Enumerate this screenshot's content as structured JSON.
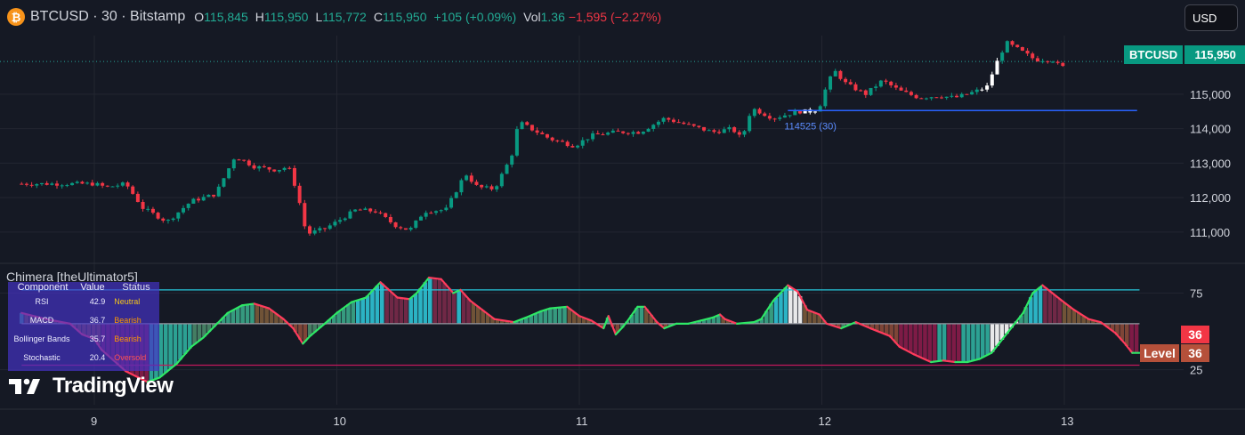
{
  "header": {
    "coin_symbol": "₿",
    "symbol_line": "BTCUSD · 30 · Bitstamp",
    "o_label": "O",
    "o_value": "115,845",
    "h_label": "H",
    "h_value": "115,950",
    "l_label": "L",
    "l_value": "115,772",
    "c_label": "C",
    "c_value": "115,950",
    "change": "+105 (+0.09%)",
    "vol_label": "Vol",
    "vol_value": "1.36",
    "vol_change": "−1,595 (−2.27%)"
  },
  "currency_button": "USD",
  "price_tag": {
    "name": "BTCUSD",
    "value": "115,950"
  },
  "indicator": {
    "title": "Chimera [theUltimator5]",
    "table": {
      "headers": [
        "Component",
        "Value",
        "Status"
      ],
      "rows": [
        {
          "component": "RSI",
          "value": "42.9",
          "status": "Neutral",
          "color": "#f5c518"
        },
        {
          "component": "MACD",
          "value": "36.7",
          "status": "Bearish",
          "color": "#ff9800"
        },
        {
          "component": "Bollinger Bands",
          "value": "35.7",
          "status": "Bearish",
          "color": "#ff9800"
        },
        {
          "component": "Stochastic",
          "value": "20.4",
          "status": "Oversold",
          "color": "#ff5252"
        }
      ]
    },
    "current_badge": "36",
    "level_label": "Level",
    "level_value": "36",
    "level_color": "#b5503a",
    "current_color": "#f23645"
  },
  "logo_text": "TradingView",
  "chart_data": [
    {
      "type": "candlestick",
      "title": "BTCUSD · 30 · Bitstamp",
      "y_ticks": [
        111000,
        112000,
        113000,
        114000,
        115000
      ],
      "y_tick_labels": [
        "111,000",
        "112,000",
        "113,000",
        "114,000",
        "115,000"
      ],
      "ylim": [
        110300,
        116700
      ],
      "x_ticks": [
        "9",
        "10",
        "11",
        "12",
        "13"
      ],
      "last_price": 115950,
      "horizontal_level": {
        "value": 114525,
        "label": "114525 (30)",
        "color": "#2962ff"
      },
      "close_path": [
        [
          0,
          112400
        ],
        [
          0.05,
          112300
        ],
        [
          0.13,
          112400
        ],
        [
          0.2,
          111700
        ],
        [
          0.3,
          111300
        ],
        [
          0.4,
          111900
        ],
        [
          0.5,
          112100
        ],
        [
          0.58,
          113200
        ],
        [
          0.66,
          112900
        ],
        [
          0.75,
          112800
        ],
        [
          0.8,
          112900
        ],
        [
          0.84,
          112100
        ],
        [
          0.86,
          111300
        ],
        [
          0.88,
          110950
        ],
        [
          0.95,
          111100
        ],
        [
          1.0,
          111300
        ],
        [
          1.08,
          111650
        ],
        [
          1.16,
          111600
        ],
        [
          1.24,
          111200
        ],
        [
          1.3,
          111050
        ],
        [
          1.36,
          111600
        ],
        [
          1.45,
          111650
        ],
        [
          1.5,
          112300
        ],
        [
          1.53,
          112700
        ],
        [
          1.58,
          112300
        ],
        [
          1.65,
          112250
        ],
        [
          1.72,
          113200
        ],
        [
          1.75,
          114200
        ],
        [
          1.8,
          114000
        ],
        [
          1.88,
          113700
        ],
        [
          1.98,
          113500
        ],
        [
          2.05,
          113800
        ],
        [
          2.15,
          113900
        ],
        [
          2.25,
          113900
        ],
        [
          2.35,
          114300
        ],
        [
          2.45,
          114100
        ],
        [
          2.55,
          113900
        ],
        [
          2.63,
          114000
        ],
        [
          2.67,
          113700
        ],
        [
          2.71,
          114600
        ],
        [
          2.8,
          114300
        ],
        [
          2.9,
          114500
        ],
        [
          2.96,
          114500
        ],
        [
          2.99,
          114600
        ],
        [
          3.0,
          114900
        ],
        [
          3.05,
          115700
        ],
        [
          3.1,
          115300
        ],
        [
          3.18,
          115000
        ],
        [
          3.25,
          115400
        ],
        [
          3.32,
          115100
        ],
        [
          3.4,
          114900
        ],
        [
          3.48,
          114950
        ],
        [
          3.55,
          114900
        ],
        [
          3.6,
          115000
        ],
        [
          3.68,
          115200
        ],
        [
          3.72,
          115900
        ],
        [
          3.76,
          116500
        ],
        [
          3.81,
          116300
        ],
        [
          3.88,
          116000
        ],
        [
          3.95,
          116000
        ],
        [
          3.99,
          115750
        ],
        [
          4.01,
          115950
        ]
      ]
    },
    {
      "type": "area",
      "title": "Chimera [theUltimator5]",
      "y_ticks": [
        25,
        75
      ],
      "y_tick_labels": [
        "25",
        "75"
      ],
      "ylim": [
        8,
        92
      ],
      "upper_band": 77,
      "mid_band": 55,
      "lower_band": 28,
      "series": [
        {
          "values": [
            [
              -0.3,
              62
            ],
            [
              -0.2,
              58
            ],
            [
              -0.1,
              55
            ],
            [
              -0.05,
              48
            ],
            [
              0.0,
              45
            ],
            [
              0.03,
              38
            ],
            [
              0.13,
              24
            ],
            [
              0.22,
              17
            ],
            [
              0.27,
              20
            ],
            [
              0.34,
              29
            ],
            [
              0.4,
              40
            ],
            [
              0.45,
              46
            ],
            [
              0.55,
              62
            ],
            [
              0.61,
              67
            ],
            [
              0.66,
              68
            ],
            [
              0.72,
              65
            ],
            [
              0.78,
              58
            ],
            [
              0.82,
              52
            ],
            [
              0.86,
              42
            ],
            [
              0.89,
              47
            ],
            [
              0.95,
              55
            ],
            [
              1.0,
              62
            ],
            [
              1.06,
              69
            ],
            [
              1.12,
              72
            ],
            [
              1.18,
              82
            ],
            [
              1.25,
              72
            ],
            [
              1.3,
              71
            ],
            [
              1.33,
              75
            ],
            [
              1.38,
              85
            ],
            [
              1.43,
              84
            ],
            [
              1.48,
              75
            ],
            [
              1.51,
              77
            ],
            [
              1.55,
              70
            ],
            [
              1.6,
              64
            ],
            [
              1.65,
              58
            ],
            [
              1.73,
              56
            ],
            [
              1.78,
              59
            ],
            [
              1.84,
              63
            ],
            [
              1.88,
              65
            ],
            [
              1.95,
              66
            ],
            [
              2.0,
              60
            ],
            [
              2.05,
              57
            ],
            [
              2.1,
              52
            ],
            [
              2.12,
              60
            ],
            [
              2.15,
              48
            ],
            [
              2.18,
              53
            ],
            [
              2.2,
              57
            ],
            [
              2.24,
              66
            ],
            [
              2.27,
              66
            ],
            [
              2.32,
              56
            ],
            [
              2.35,
              52
            ],
            [
              2.4,
              55
            ],
            [
              2.45,
              55
            ],
            [
              2.5,
              57
            ],
            [
              2.55,
              59
            ],
            [
              2.58,
              61
            ],
            [
              2.6,
              58
            ],
            [
              2.65,
              55
            ],
            [
              2.72,
              56
            ],
            [
              2.75,
              58
            ],
            [
              2.8,
              70
            ],
            [
              2.86,
              80
            ],
            [
              2.9,
              76
            ],
            [
              2.94,
              64
            ],
            [
              2.99,
              61
            ],
            [
              3.02,
              55
            ],
            [
              3.08,
              52
            ],
            [
              3.14,
              56
            ],
            [
              3.2,
              52
            ],
            [
              3.28,
              47
            ],
            [
              3.32,
              40
            ],
            [
              3.38,
              35
            ],
            [
              3.45,
              30
            ],
            [
              3.5,
              31
            ],
            [
              3.55,
              30
            ],
            [
              3.6,
              30
            ],
            [
              3.65,
              32
            ],
            [
              3.7,
              36
            ],
            [
              3.73,
              42
            ],
            [
              3.78,
              52
            ],
            [
              3.83,
              62
            ],
            [
              3.87,
              75
            ],
            [
              3.91,
              80
            ],
            [
              3.95,
              75
            ],
            [
              3.99,
              70
            ],
            [
              4.04,
              64
            ],
            [
              4.1,
              58
            ],
            [
              4.15,
              56
            ],
            [
              4.21,
              49
            ],
            [
              4.25,
              42
            ],
            [
              4.28,
              36
            ],
            [
              4.31,
              36
            ]
          ]
        }
      ]
    }
  ]
}
